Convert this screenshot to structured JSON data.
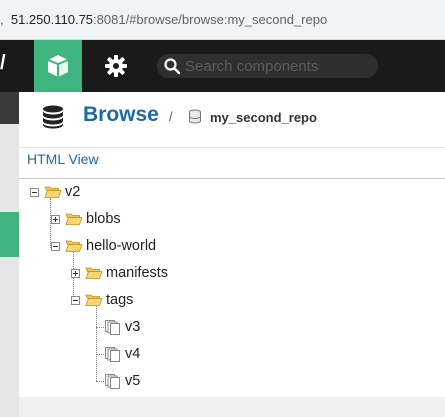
{
  "address_bar": {
    "prefix": ",",
    "host": "51.250.110.75",
    "path": ":8081/#browse/browse:my_second_repo"
  },
  "topnav": {
    "brand_fragment": "/",
    "search_placeholder": "Search components",
    "browse_icon": "cube-icon",
    "settings_icon": "gear-icon",
    "accent_color": "#3fb47e"
  },
  "header": {
    "title": "Browse",
    "separator": "/",
    "repo_name": "my_second_repo",
    "title_icon": "database-icon"
  },
  "html_view_link": "HTML View",
  "tree": [
    {
      "label": "v2",
      "type": "folder",
      "state": "expanded"
    },
    {
      "label": "blobs",
      "type": "folder",
      "state": "collapsed"
    },
    {
      "label": "hello-world",
      "type": "folder",
      "state": "expanded"
    },
    {
      "label": "manifests",
      "type": "folder",
      "state": "collapsed"
    },
    {
      "label": "tags",
      "type": "folder",
      "state": "expanded"
    },
    {
      "label": "v3",
      "type": "file"
    },
    {
      "label": "v4",
      "type": "file"
    },
    {
      "label": "v5",
      "type": "file"
    }
  ]
}
